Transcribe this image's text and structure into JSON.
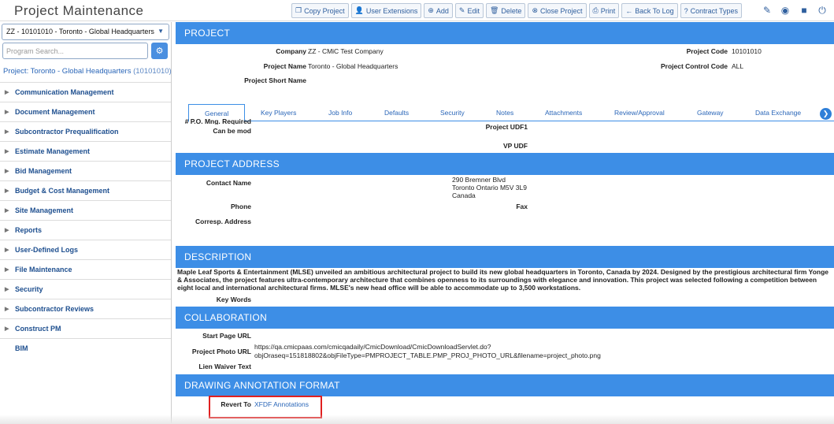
{
  "app": {
    "title": "Project Maintenance"
  },
  "toolbar": [
    {
      "label": "Copy Project",
      "icon": "copy-icon",
      "glyph": "❐"
    },
    {
      "label": "User Extensions",
      "icon": "user-plus-icon",
      "glyph": "👤"
    },
    {
      "label": "Add",
      "icon": "plus-circle-icon",
      "glyph": "⊕"
    },
    {
      "label": "Edit",
      "icon": "pencil-icon",
      "glyph": "✎"
    },
    {
      "label": "Delete",
      "icon": "trash-icon",
      "glyph": "🗑"
    },
    {
      "label": "Close Project",
      "icon": "close-circle-icon",
      "glyph": "⊗"
    },
    {
      "label": "Print",
      "icon": "print-icon",
      "glyph": "⎙"
    },
    {
      "label": "Back To Log",
      "icon": "arrow-left-icon",
      "glyph": "←"
    },
    {
      "label": "Contract Types",
      "icon": "help-circle-icon",
      "glyph": "?"
    }
  ],
  "top_right_icons": [
    "edit-square-icon",
    "user-circle-icon",
    "stop-icon",
    "power-icon"
  ],
  "sidebar": {
    "project_select": "ZZ - 10101010 - Toronto - Global Headquarters",
    "search_placeholder": "Program Search...",
    "project_link": "Project: Toronto - Global Headquarters",
    "project_code": "(10101010)",
    "items": [
      {
        "label": "Communication Management",
        "arrow": true
      },
      {
        "label": "Document Management",
        "arrow": true
      },
      {
        "label": "Subcontractor Prequalification",
        "arrow": true
      },
      {
        "label": "Estimate Management",
        "arrow": true
      },
      {
        "label": "Bid Management",
        "arrow": true
      },
      {
        "label": "Budget & Cost Management",
        "arrow": true
      },
      {
        "label": "Site Management",
        "arrow": true
      },
      {
        "label": "Reports",
        "arrow": true
      },
      {
        "label": "User-Defined Logs",
        "arrow": true
      },
      {
        "label": "File Maintenance",
        "arrow": true
      },
      {
        "label": "Security",
        "arrow": true
      },
      {
        "label": "Subcontractor Reviews",
        "arrow": true
      },
      {
        "label": "Construct PM",
        "arrow": true
      },
      {
        "label": "BIM",
        "arrow": false
      }
    ]
  },
  "project": {
    "header": "PROJECT",
    "company_label": "Company",
    "company_value": "ZZ - CMiC Test Company",
    "project_code_label": "Project Code",
    "project_code_value": "10101010",
    "project_name_label": "Project Name",
    "project_name_value": "Toronto - Global Headquarters",
    "control_code_label": "Project Control Code",
    "control_code_value": "ALL",
    "short_name_label": "Project Short Name"
  },
  "tabs": [
    "General",
    "Key Players",
    "Job Info",
    "Defaults",
    "Security",
    "Notes",
    "Attachments",
    "Review/Approval",
    "Gateway",
    "Data Exchange"
  ],
  "general": {
    "clipped_label": "# P.O. Mng. Required",
    "can_be_mod_label": "Can be mod",
    "udf1_label": "Project UDF1",
    "vp_udf_label": "VP UDF"
  },
  "address": {
    "header": "PROJECT ADDRESS",
    "contact_label": "Contact Name",
    "address_line1": "290 Bremner Blvd",
    "address_line2": "Toronto Ontario M5V 3L9",
    "address_line3": "Canada",
    "phone_label": "Phone",
    "fax_label": "Fax",
    "corresp_label": "Corresp. Address"
  },
  "description": {
    "header": "DESCRIPTION",
    "text": "Maple Leaf Sports & Entertainment (MLSE) unveiled an ambitious architectural project to build its new global headquarters in Toronto, Canada by 2024. Designed by the prestigious architectural firm Yonge & Associates, the project features ultra-contemporary architecture that combines openness to its surroundings with elegance and innovation. This project was selected following a competition between eight local and international architectural firms. MLSE's new head office will be able to accommodate up to 3,500 workstations.",
    "keywords_label": "Key Words"
  },
  "collaboration": {
    "header": "COLLABORATION",
    "start_page_label": "Start Page URL",
    "photo_url_label": "Project Photo URL",
    "photo_url_line1": "https://qa.cmicpaas.com/cmicqadaily/CmicDownload/CmicDownloadServlet.do?",
    "photo_url_line2": "objOraseq=151818802&objFileType=PMPROJECT_TABLE.PMP_PROJ_PHOTO_URL&filename=project_photo.png",
    "lien_label": "Lien Waiver Text"
  },
  "drawing": {
    "header": "DRAWING ANNOTATION FORMAT",
    "revert_label": "Revert To",
    "revert_value": "XFDF Annotations"
  },
  "colors": {
    "accent": "#3d8ee6",
    "link": "#2a66b8",
    "highlight": "#e02020"
  }
}
